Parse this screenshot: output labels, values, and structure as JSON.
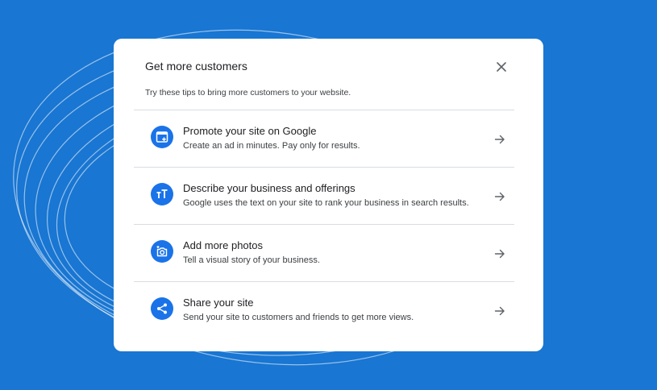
{
  "dialog": {
    "title": "Get more customers",
    "subtitle": "Try these tips to bring more customers to your website.",
    "close_icon": "close-icon"
  },
  "items": [
    {
      "icon": "ad-window-icon",
      "title": "Promote your site on Google",
      "description": "Create an ad in minutes. Pay only for results."
    },
    {
      "icon": "text-size-icon",
      "title": "Describe your business and offerings",
      "description": "Google uses the text on your site to rank your business in search results."
    },
    {
      "icon": "add-photo-icon",
      "title": "Add more photos",
      "description": "Tell a visual story of your business."
    },
    {
      "icon": "share-icon",
      "title": "Share your site",
      "description": "Send your site to customers and friends to get more views."
    }
  ],
  "colors": {
    "background": "#1976d2",
    "accent": "#1a73e8"
  }
}
